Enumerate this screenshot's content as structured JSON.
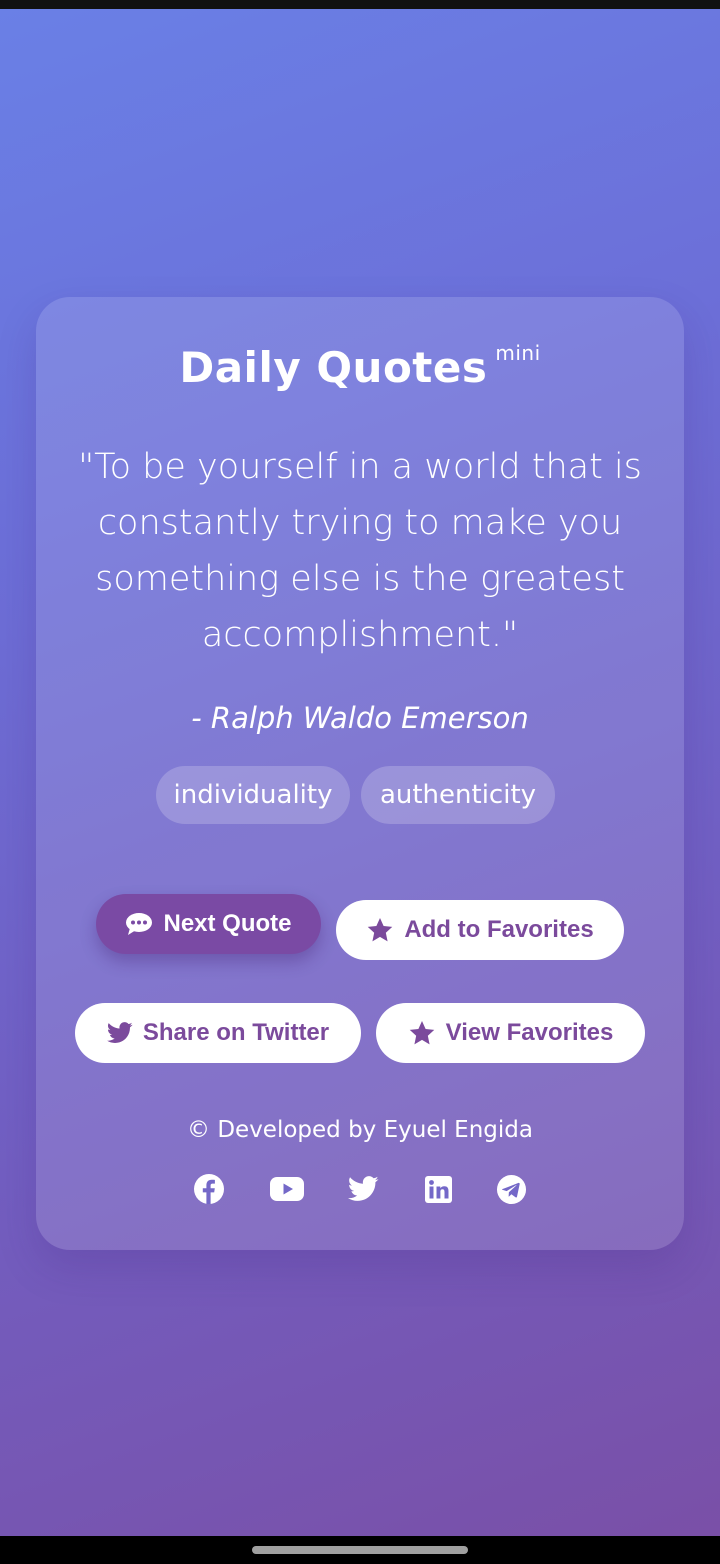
{
  "app": {
    "title": "Daily Quotes",
    "title_badge": "mini"
  },
  "quote": {
    "text": "\"To be yourself in a world that is constantly trying to make you something else is the greatest accomplishment.\"",
    "author": "- Ralph Waldo Emerson",
    "tags": [
      "individuality",
      "authenticity"
    ]
  },
  "actions": {
    "next_label": "Next Quote",
    "add_favorite_label": "Add to Favorites",
    "share_label": "Share on Twitter",
    "view_favorites_label": "View Favorites"
  },
  "footer": {
    "credit": "© Developed by Eyuel Engida",
    "social_icons": [
      "facebook-icon",
      "youtube-icon",
      "twitter-icon",
      "linkedin-icon",
      "telegram-icon"
    ]
  },
  "colors": {
    "accent": "#7a4aa4",
    "button_text": "#7b4a9c",
    "background_start": "#6a80e6",
    "background_end": "#7a4fa6"
  }
}
